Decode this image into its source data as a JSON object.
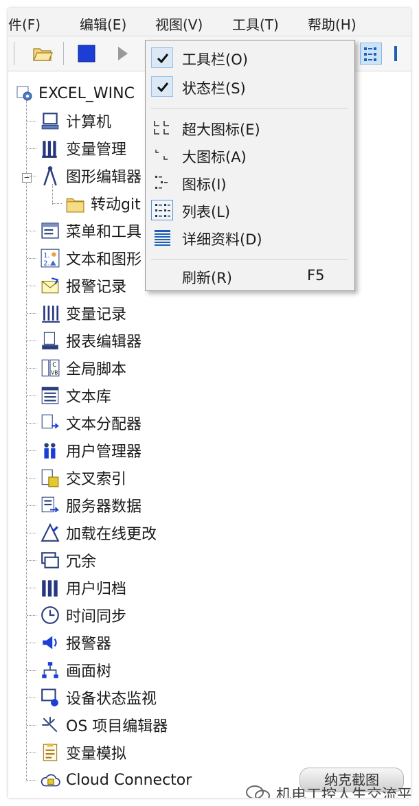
{
  "menubar": {
    "items": [
      "文件(F)",
      "编辑(E)",
      "视图(V)",
      "工具(T)",
      "帮助(H)"
    ],
    "items_visible": [
      "件(F)",
      "编辑(E)",
      "视图(V)",
      "工具(T)",
      "帮助(H)"
    ]
  },
  "toolbar": {
    "buttons": [
      "open-folder-icon",
      "stop-icon",
      "play-icon",
      "list-view-icon",
      "details-view-icon"
    ]
  },
  "tree": {
    "root": "EXCEL_WINC",
    "items": [
      {
        "label": "计算机",
        "icon": "computer-icon"
      },
      {
        "label": "变量管理",
        "icon": "tag-management-icon"
      },
      {
        "label": "图形编辑器",
        "icon": "graphics-designer-icon"
      },
      {
        "label": "转动git",
        "icon": "folder-icon"
      },
      {
        "label": "菜单和工具",
        "icon": "menu-toolbar-icon"
      },
      {
        "label": "文本和图形",
        "icon": "text-graphics-icon"
      },
      {
        "label": "报警记录",
        "icon": "alarm-logging-icon"
      },
      {
        "label": "变量记录",
        "icon": "tag-logging-icon"
      },
      {
        "label": "报表编辑器",
        "icon": "report-designer-icon"
      },
      {
        "label": "全局脚本",
        "icon": "global-script-icon"
      },
      {
        "label": "文本库",
        "icon": "text-library-icon"
      },
      {
        "label": "文本分配器",
        "icon": "text-distributor-icon"
      },
      {
        "label": "用户管理器",
        "icon": "user-administrator-icon"
      },
      {
        "label": "交叉索引",
        "icon": "cross-reference-icon"
      },
      {
        "label": "服务器数据",
        "icon": "server-data-icon"
      },
      {
        "label": "加载在线更改",
        "icon": "load-online-changes-icon"
      },
      {
        "label": "冗余",
        "icon": "redundancy-icon"
      },
      {
        "label": "用户归档",
        "icon": "user-archive-icon"
      },
      {
        "label": "时间同步",
        "icon": "time-sync-icon"
      },
      {
        "label": "报警器",
        "icon": "horn-icon"
      },
      {
        "label": "画面树",
        "icon": "picture-tree-icon"
      },
      {
        "label": "设备状态监视",
        "icon": "device-status-icon"
      },
      {
        "label": "OS 项目编辑器",
        "icon": "os-project-editor-icon"
      },
      {
        "label": "变量模拟",
        "icon": "tag-simulator-icon"
      },
      {
        "label": "Cloud Connector",
        "icon": "cloud-connector-icon"
      }
    ]
  },
  "context_menu": {
    "items": [
      {
        "label": "工具栏(O)",
        "checked": true,
        "icon": "check-icon"
      },
      {
        "label": "状态栏(S)",
        "checked": true,
        "icon": "check-icon"
      },
      {
        "label": "超大图标(E)",
        "icon": "extra-large-icons-icon"
      },
      {
        "label": "大图标(A)",
        "icon": "large-icons-icon"
      },
      {
        "label": "图标(I)",
        "icon": "small-icons-icon"
      },
      {
        "label": "列表(L)",
        "icon": "list-icon",
        "selected": true
      },
      {
        "label": "详细资料(D)",
        "icon": "details-icon"
      },
      {
        "label": "刷新(R)",
        "shortcut": "F5"
      }
    ]
  },
  "watermark": {
    "badge": "纳克截图",
    "text": "机电工控人生交流平台"
  },
  "colors": {
    "accent_blue": "#1f5fbf",
    "check_bg": "#dbe9f6",
    "menu_bg": "#f2f2f2"
  }
}
